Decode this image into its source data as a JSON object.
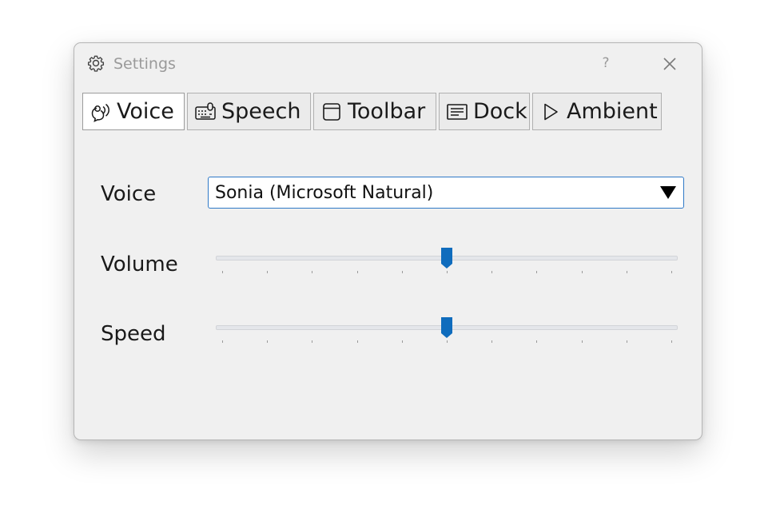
{
  "window": {
    "title": "Settings",
    "title_icon": "gear-icon",
    "help_label": "?",
    "close_icon": "close-icon"
  },
  "tabs": [
    {
      "label": "Voice",
      "icon": "voice-icon",
      "active": true
    },
    {
      "label": "Speech",
      "icon": "keyboard-icon",
      "active": false
    },
    {
      "label": "Toolbar",
      "icon": "window-icon",
      "active": false
    },
    {
      "label": "Dock",
      "icon": "dock-icon",
      "active": false
    },
    {
      "label": "Ambient",
      "icon": "play-icon",
      "active": false
    }
  ],
  "voice": {
    "label": "Voice",
    "selected": "Sonia (Microsoft Natural)"
  },
  "volume": {
    "label": "Volume",
    "value": 0.5
  },
  "speed": {
    "label": "Speed",
    "value": 0.5
  },
  "colors": {
    "accent": "#0f6cbd",
    "window_bg": "#f0f0f0"
  }
}
